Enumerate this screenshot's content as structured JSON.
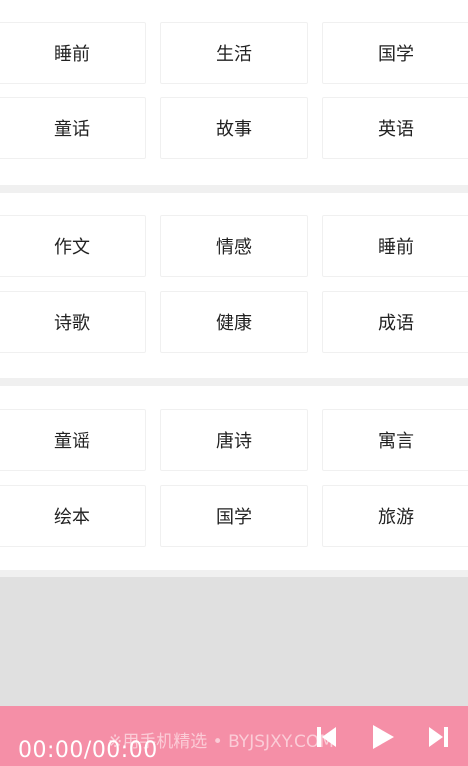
{
  "groups": [
    {
      "rows": [
        [
          "睡前",
          "生活",
          "国学"
        ],
        [
          "童话",
          "故事",
          "英语"
        ]
      ]
    },
    {
      "rows": [
        [
          "作文",
          "情感",
          "睡前"
        ],
        [
          "诗歌",
          "健康",
          "成语"
        ]
      ]
    },
    {
      "rows": [
        [
          "童谣",
          "唐诗",
          "寓言"
        ],
        [
          "绘本",
          "国学",
          "旅游"
        ]
      ]
    }
  ],
  "player": {
    "time": "00:00/00:00",
    "watermark": "※用手机精选 • BYJSJXY.COM",
    "accent_color": "#f58fa7",
    "controls": [
      "previous-icon",
      "play-icon",
      "next-icon"
    ]
  }
}
